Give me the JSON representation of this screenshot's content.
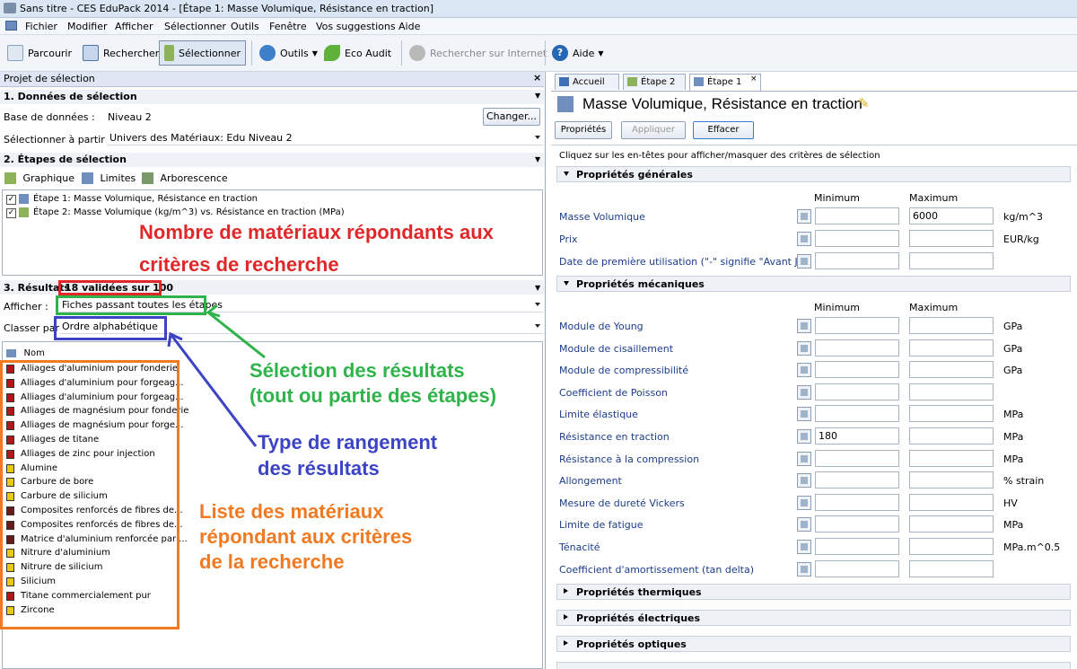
{
  "window": {
    "title": "Sans titre - CES EduPack 2014 - [Étape 1: Masse Volumique, Résistance en traction]"
  },
  "menu": [
    "Fichier",
    "Modifier",
    "Afficher",
    "Sélectionner",
    "Outils",
    "Fenêtre",
    "Vos suggestions",
    "Aide"
  ],
  "toolbar": {
    "parcourir": "Parcourir",
    "rechercher": "Rechercher",
    "selectionner": "Sélectionner",
    "outils": "Outils",
    "eco_audit": "Eco Audit",
    "rechercher_internet": "Rechercher sur Internet",
    "aide": "Aide"
  },
  "left": {
    "panel_title": "Projet de sélection",
    "section1": {
      "title": "1. Données de sélection",
      "db_label": "Base de données :",
      "db_value": "Niveau 2",
      "change_button": "Changer...",
      "select_from_label": "Sélectionner à partir de :",
      "select_from_value": "Univers des Matériaux: Edu Niveau 2"
    },
    "section2": {
      "title": "2. Étapes de sélection",
      "tools": [
        "Graphique",
        "Limites",
        "Arborescence"
      ],
      "stages": [
        "Étape 1: Masse Volumique, Résistance en traction",
        "Étape 2: Masse Volumique (kg/m^3) vs. Résistance en traction (MPa)"
      ]
    },
    "section3": {
      "title": "3. Résultats",
      "count": "18 validées sur 100",
      "afficher_label": "Afficher :",
      "afficher_value": "Fiches passant toutes les étapes",
      "classer_label": "Classer par :",
      "classer_value": "Ordre alphabétique",
      "list_header": "Nom",
      "materials": [
        "Alliages d'aluminium pour fonderie",
        "Alliages d'aluminium pour forgeag...",
        "Alliages d'aluminium pour forgeag...",
        "Alliages de magnésium pour fonderie",
        "Alliages de magnésium pour forge...",
        "Alliages de titane",
        "Alliages de zinc pour injection",
        "Alumine",
        "Carbure de bore",
        "Carbure de silicium",
        "Composites renforcés de fibres de...",
        "Composites renforcés de fibres de...",
        "Matrice d'aluminium renforcée par ...",
        "Nitrure d'aluminium",
        "Nitrure de silicium",
        "Silicium",
        "Titane commercialement pur",
        "Zircone"
      ],
      "material_icon_colors": [
        "#b01818",
        "#b01818",
        "#b01818",
        "#b01818",
        "#b01818",
        "#b01818",
        "#b01818",
        "#e8c814",
        "#e8c814",
        "#e8c814",
        "#6a1a1a",
        "#6a1a1a",
        "#6a1a1a",
        "#e8c814",
        "#e8c814",
        "#e8c814",
        "#b01818",
        "#e8c814"
      ]
    }
  },
  "annotations": {
    "red_line1": "Nombre de matériaux répondants aux",
    "red_line2": "critères de recherche",
    "green_line1": "Sélection des résultats",
    "green_line2": "(tout ou partie des étapes)",
    "blue_line1": "Type de rangement",
    "blue_line2": "des résultats",
    "orange_line1": "Liste des matériaux",
    "orange_line2": "répondant aux critères",
    "orange_line3": "de la recherche",
    "colors": {
      "red": "#e0282a",
      "green": "#2fb34a",
      "blue": "#3c44c4",
      "orange": "#f07a22"
    }
  },
  "right": {
    "tabs": [
      "Accueil",
      "Étape 2",
      "Étape 1"
    ],
    "heading": "Masse Volumique, Résistance en traction",
    "buttons": {
      "proprietes": "Propriétés",
      "appliquer": "Appliquer",
      "effacer": "Effacer"
    },
    "hint": "Cliquez sur les en-têtes pour afficher/masquer des critères de sélection",
    "min_label": "Minimum",
    "max_label": "Maximum",
    "groups": {
      "generales": "Propriétés générales",
      "mecaniques": "Propriétés mécaniques",
      "thermiques": "Propriétés thermiques",
      "electriques": "Propriétés électriques",
      "optiques": "Propriétés optiques"
    },
    "general_props": [
      {
        "name": "Masse Volumique",
        "min": "",
        "max": "6000",
        "unit": "kg/m^3"
      },
      {
        "name": "Prix",
        "min": "",
        "max": "",
        "unit": "EUR/kg"
      },
      {
        "name": "Date de première utilisation (\"-\" signifie \"Avant Jés",
        "min": "",
        "max": "",
        "unit": ""
      }
    ],
    "mech_props": [
      {
        "name": "Module de Young",
        "min": "",
        "max": "",
        "unit": "GPa"
      },
      {
        "name": "Module de cisaillement",
        "min": "",
        "max": "",
        "unit": "GPa"
      },
      {
        "name": "Module de compressibilité",
        "min": "",
        "max": "",
        "unit": "GPa"
      },
      {
        "name": "Coefficient de Poisson",
        "min": "",
        "max": "",
        "unit": ""
      },
      {
        "name": "Limite élastique",
        "min": "",
        "max": "",
        "unit": "MPa"
      },
      {
        "name": "Résistance en traction",
        "min": "180",
        "max": "",
        "unit": "MPa"
      },
      {
        "name": "Résistance à la compression",
        "min": "",
        "max": "",
        "unit": "MPa"
      },
      {
        "name": "Allongement",
        "min": "",
        "max": "",
        "unit": "% strain"
      },
      {
        "name": "Mesure de dureté Vickers",
        "min": "",
        "max": "",
        "unit": "HV"
      },
      {
        "name": "Limite de fatigue",
        "min": "",
        "max": "",
        "unit": "MPa"
      },
      {
        "name": "Ténacité",
        "min": "",
        "max": "",
        "unit": "MPa.m^0.5"
      },
      {
        "name": "Coefficient d'amortissement (tan delta)",
        "min": "",
        "max": "",
        "unit": ""
      }
    ]
  }
}
